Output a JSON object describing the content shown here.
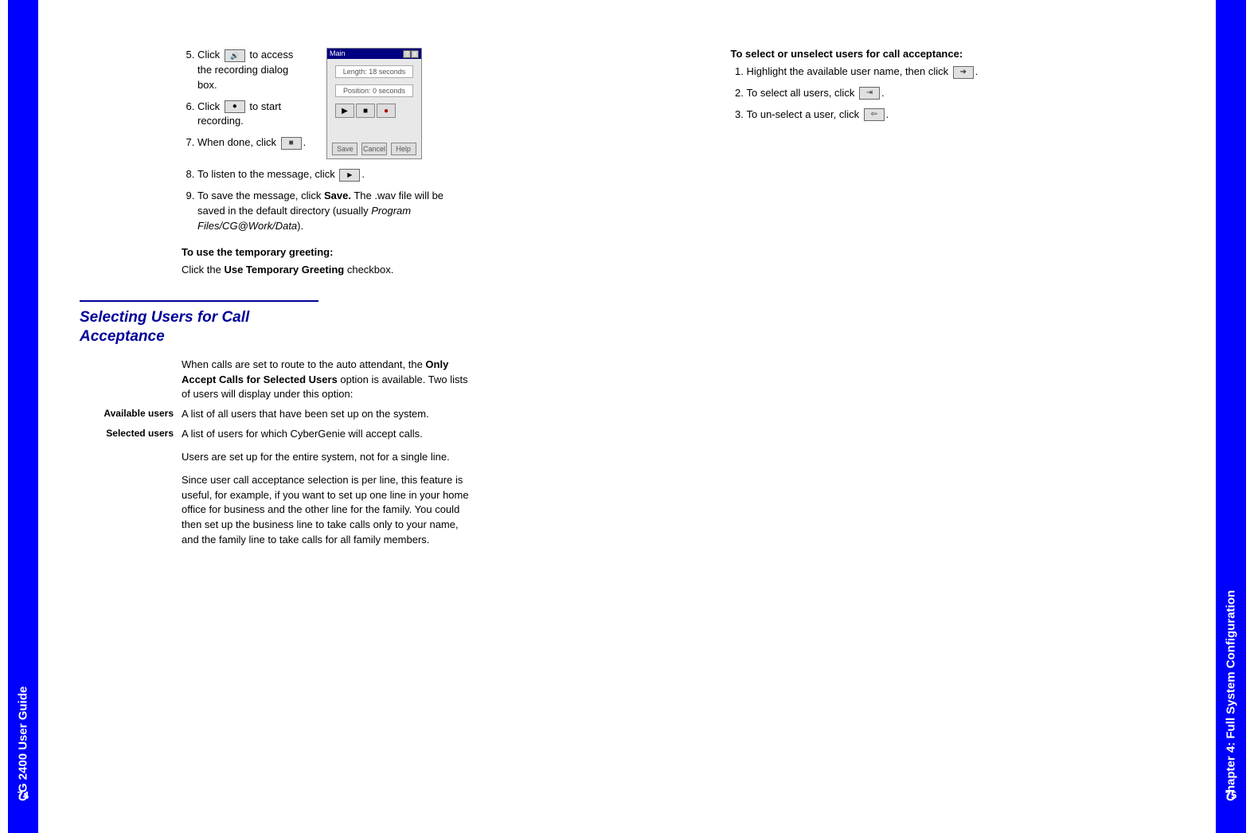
{
  "leftSidebar": "CG 2400 User Guide",
  "rightSidebar": "Chapter 4: Full System Configuration",
  "leftPageNum": "74",
  "rightPageNum": "75",
  "dialog": {
    "title": "Main",
    "lengthLabel": "Length: 18 seconds",
    "posLabel": "Position: 0 seconds",
    "save": "Save",
    "cancel": "Cancel",
    "help": "Help"
  },
  "steps": {
    "s5a": "Click ",
    "s5b": " to access the recording dialog box.",
    "s6a": "Click ",
    "s6b": " to start recording.",
    "s7a": "When done, click ",
    "s7b": ".",
    "s8a": "To listen to the message, click ",
    "s8b": ".",
    "s9a": "To save the message, click ",
    "s9bold": "Save.",
    "s9b": " The .wav file will be saved in the default directory (usually ",
    "s9italic": "Program Files/CG@Work/Data",
    "s9c": ")."
  },
  "tempGreetHead": "To use the temporary greeting:",
  "tempGreet1": "Click the ",
  "tempGreetBold": "Use Temporary Greeting",
  "tempGreet2": " checkbox.",
  "sectionHeading": "Selecting Users for Call Acceptance",
  "introA": "When calls are set to route to the auto attendant, the ",
  "introBold": "Only Accept Calls for Selected Users ",
  "introB": " option is available. Two lists of users will display under this option:",
  "defs": {
    "t1": "Available users",
    "d1": "A list of all users that have been set up on the system.",
    "t2": "Selected users",
    "d2": "A list of users for which CyberGenie will accept calls."
  },
  "body1": "Users are set up for the entire system, not for a single line.",
  "body2": "Since user call acceptance selection is per line, this feature is useful, for example, if you want to set up one line in your home office for business and the other line for the family. You could then set up the business line to take calls only to your name, and the family line to take calls for all family members.",
  "right": {
    "head": "To select or unselect users for call acceptance:",
    "s1a": "Highlight the available user name, then click ",
    "s1b": ".",
    "s2a": "To select all users, click ",
    "s2b": ".",
    "s3a": "To un-select a user, click ",
    "s3b": "."
  }
}
